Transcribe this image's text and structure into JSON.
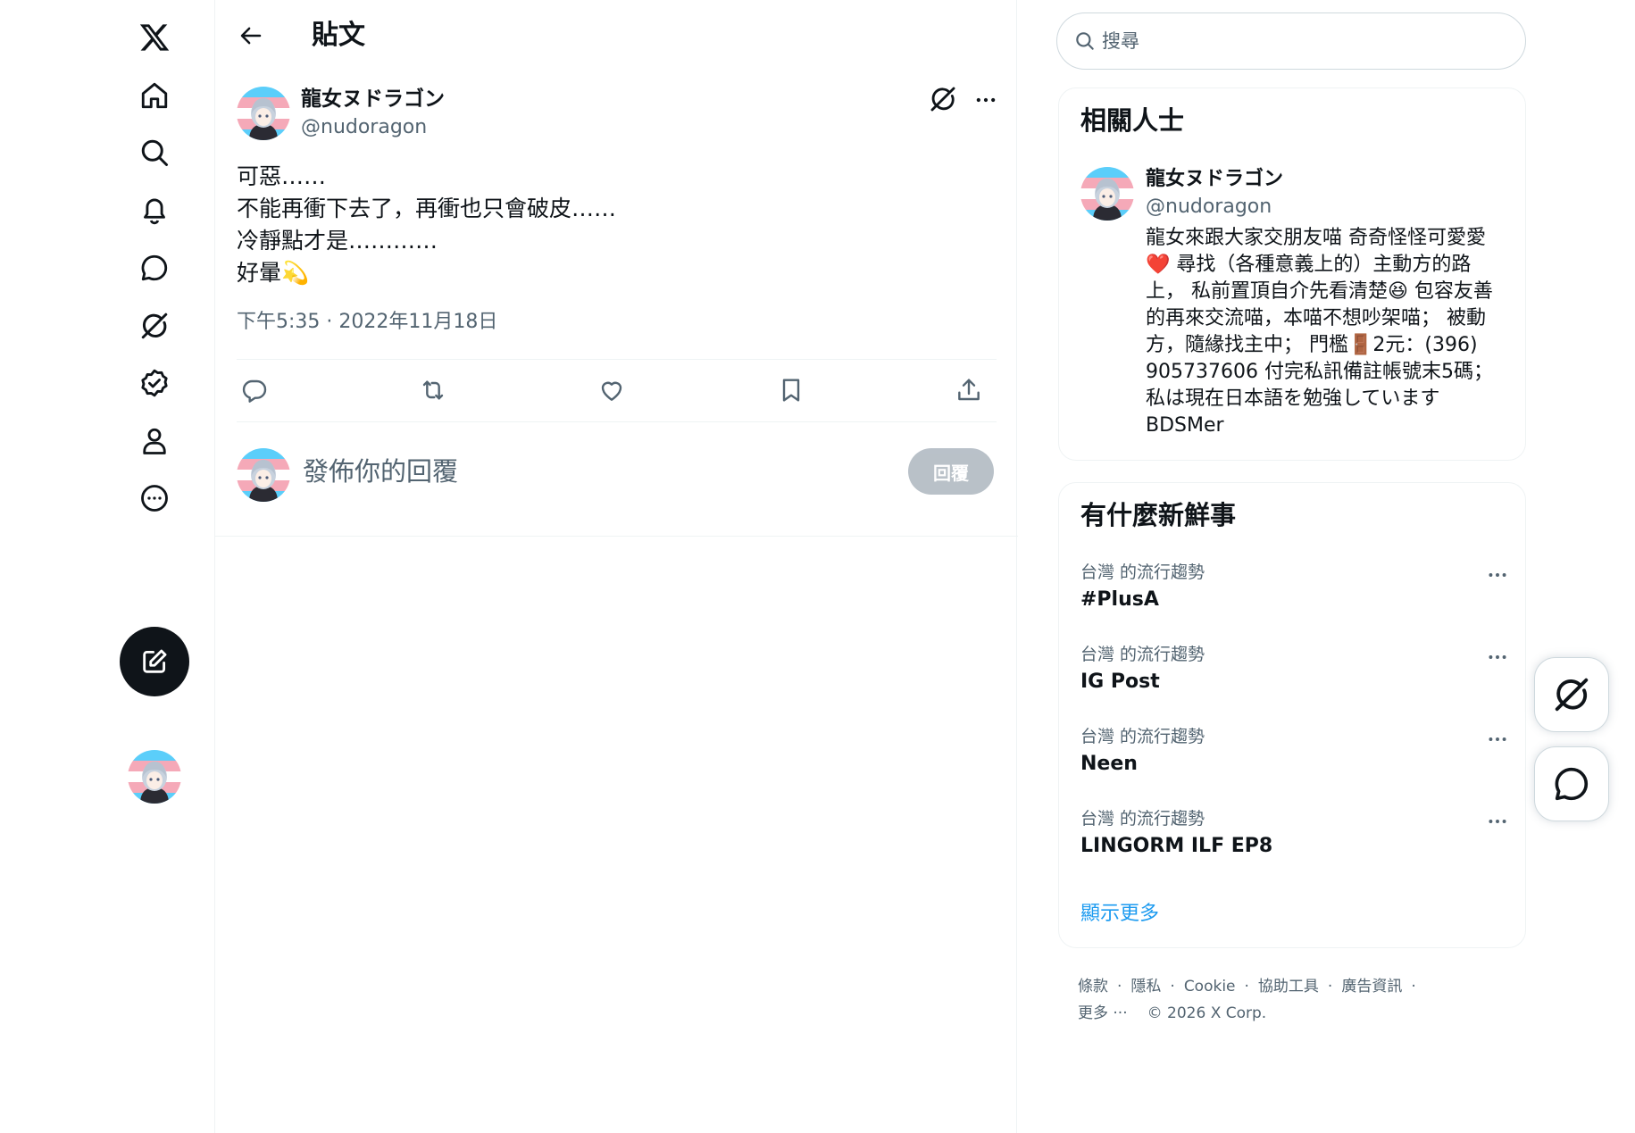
{
  "nav": {
    "items": [
      {
        "name": "x-logo",
        "label": "X"
      },
      {
        "name": "home",
        "label": "首頁"
      },
      {
        "name": "explore",
        "label": "探索"
      },
      {
        "name": "notifications",
        "label": "通知"
      },
      {
        "name": "messages",
        "label": "訊息"
      },
      {
        "name": "grok",
        "label": "Grok"
      },
      {
        "name": "verified",
        "label": "認證"
      },
      {
        "name": "profile",
        "label": "個人資料"
      },
      {
        "name": "more",
        "label": "更多"
      }
    ]
  },
  "header": {
    "title": "貼文"
  },
  "post": {
    "author_name": "龍女ヌドラゴン",
    "author_handle": "@nudoragon",
    "text_lines": [
      "可惡……",
      "不能再衝下去了，再衝也只會破皮……",
      "冷靜點才是…………",
      "好暈💫"
    ],
    "timestamp": "下午5:35 · 2022年11月18日"
  },
  "reply": {
    "placeholder": "發佈你的回覆",
    "button_label": "回覆"
  },
  "search": {
    "placeholder": "搜尋"
  },
  "relevant": {
    "title": "相關人士",
    "name": "龍女ヌドラゴン",
    "handle": "@nudoragon",
    "bio_lines": [
      "龍女來跟大家交朋友喵 奇奇怪怪可愛愛",
      "❤️ 尋找（各種意義上的）主動方的路",
      "上， 私前置頂自介先看清楚😆 包容友善",
      "的再來交流喵，本喵不想吵架喵； 被動",
      "方，隨緣找主中； 門檻🚪2元：(396)",
      "905737606 付完私訊備註帳號末5碼；",
      "私は現在日本語を勉強しています",
      "BDSMer"
    ]
  },
  "trends": {
    "title": "有什麼新鮮事",
    "items": [
      {
        "category": "台灣 的流行趨勢",
        "name": "#PlusA"
      },
      {
        "category": "台灣 的流行趨勢",
        "name": "IG Post"
      },
      {
        "category": "台灣 的流行趨勢",
        "name": "Neen"
      },
      {
        "category": "台灣 的流行趨勢",
        "name": "LINGORM ILF EP8"
      }
    ],
    "show_more": "顯示更多"
  },
  "footer": {
    "links": [
      "條款",
      "隱私",
      "Cookie",
      "協助工具",
      "廣告資訊"
    ],
    "more": "更多 ···",
    "copyright": "© 2026 X Corp."
  },
  "colors": {
    "accent": "#1d9bf0",
    "text": "#0f1419",
    "secondary": "#536471",
    "border": "#eff3f4"
  }
}
